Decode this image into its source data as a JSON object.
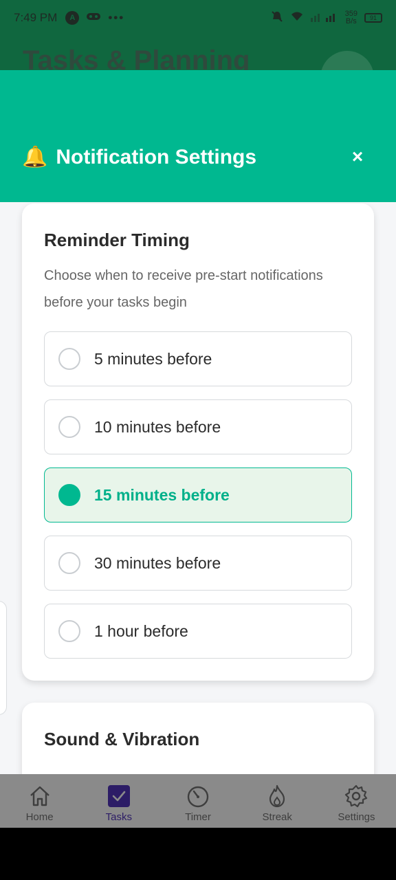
{
  "status_bar": {
    "time": "7:49 PM",
    "app_icon_letter": "A",
    "more": "•••",
    "speed_value": "359",
    "speed_unit": "B/s",
    "battery": "91"
  },
  "background_app": {
    "title": "Tasks & Planning"
  },
  "modal": {
    "icon": "🔔",
    "title": "Notification Settings",
    "close_label": "×"
  },
  "reminder": {
    "title": "Reminder Timing",
    "description": "Choose when to receive pre-start notifications before your tasks begin",
    "options": [
      {
        "label": "5 minutes before",
        "selected": false
      },
      {
        "label": "10 minutes before",
        "selected": false
      },
      {
        "label": "15 minutes before",
        "selected": true
      },
      {
        "label": "30 minutes before",
        "selected": false
      },
      {
        "label": "1 hour before",
        "selected": false
      }
    ]
  },
  "sound": {
    "title": "Sound & Vibration"
  },
  "nav": {
    "items": [
      {
        "label": "Home",
        "icon": "home-icon"
      },
      {
        "label": "Tasks",
        "icon": "tasks-check-icon",
        "active": true
      },
      {
        "label": "Timer",
        "icon": "timer-icon"
      },
      {
        "label": "Streak",
        "icon": "flame-icon"
      },
      {
        "label": "Settings",
        "icon": "gear-icon"
      }
    ]
  },
  "colors": {
    "accent": "#00b890",
    "selected_bg": "#e8f5ea",
    "active_nav": "#5b3fc4"
  }
}
